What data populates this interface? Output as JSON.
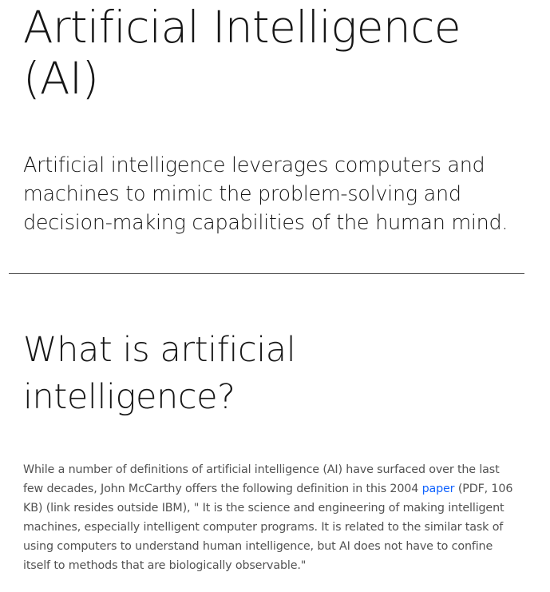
{
  "article": {
    "title": "Artificial Intelligence (AI)",
    "lede": "Artificial intelligence leverages computers and machines to mimic the problem-solving and decision-making capabilities of the human mind.",
    "section_heading": "What is artificial intelligence?",
    "paragraph": {
      "before_link": "While a number of definitions of artificial intelligence (AI) have surfaced over the last few decades, John McCarthy offers the following definition in this 2004 ",
      "link_text": "paper",
      "after_link": " (PDF, 106 KB) (link resides outside IBM), \" It is the science and engineering of making intelligent machines, especially intelligent computer programs. It is related to the similar task of using computers to understand human intelligence, but AI does not have to confine itself to methods that are biologically observable.\""
    }
  },
  "colors": {
    "heading": "#161616",
    "body": "#525252",
    "link": "#0f62fe",
    "divider": "#525252"
  }
}
